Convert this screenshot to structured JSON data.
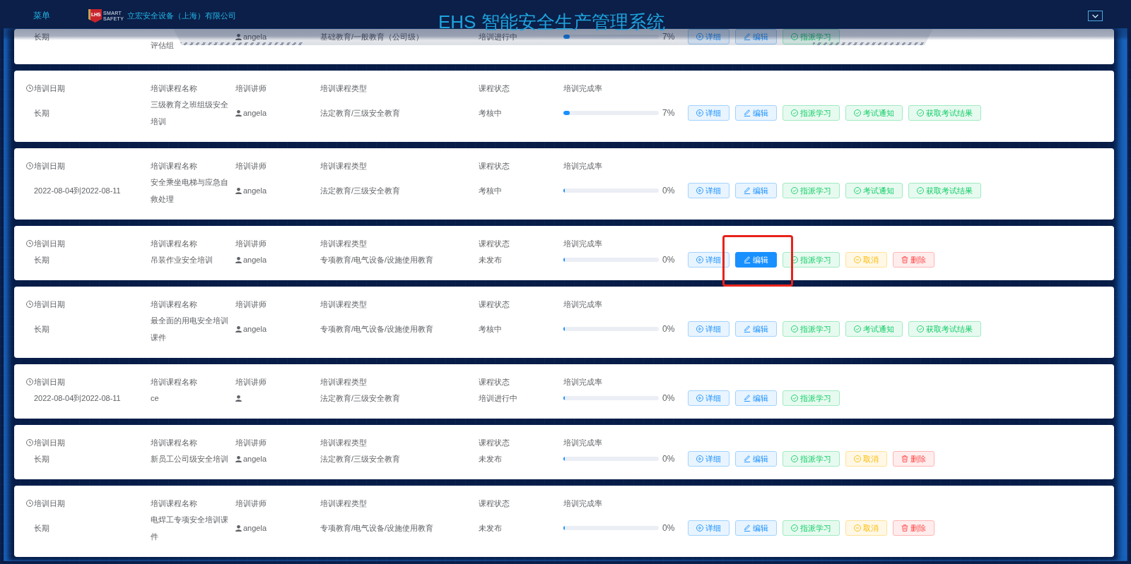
{
  "header": {
    "menu": "菜单",
    "logo": {
      "badge": "LHS",
      "line_1": "SMART",
      "line_2": "SAFETY"
    },
    "company": "立宏安全设备（上海）有限公司",
    "title": "EHS 智能安全生产管理系统"
  },
  "cards": [
    {
      "partial": true,
      "date": "长期",
      "course": "评估组",
      "teacher": "angela",
      "type": "基础教育/一般教育（公司级）",
      "status": "培训进行中",
      "progress": {
        "level": 0.07,
        "reading": "7%"
      },
      "buttons": [
        {
          "kind": "detail",
          "label": "详细",
          "active": false,
          "marked": false
        },
        {
          "kind": "edit",
          "label": "编辑",
          "active": false,
          "marked": false
        },
        {
          "kind": "assign",
          "label": "指派学习",
          "active": false,
          "marked": false
        }
      ]
    },
    {
      "partial": false,
      "labels": [
        "培训日期",
        "培训课程名称",
        "培训讲师",
        "培训课程类型",
        "课程状态",
        "培训完成率"
      ],
      "date": "长期",
      "course": "三级教育之班组级安全培训",
      "teacher": "angela",
      "type": "法定教育/三级安全教育",
      "status": "考核中",
      "progress": {
        "level": 0.07,
        "reading": "7%"
      },
      "buttons": [
        {
          "kind": "detail",
          "label": "详细",
          "active": false,
          "marked": false
        },
        {
          "kind": "edit",
          "label": "编辑",
          "active": false,
          "marked": false
        },
        {
          "kind": "assign",
          "label": "指派学习",
          "active": false,
          "marked": false
        },
        {
          "kind": "notify",
          "label": "考试通知",
          "active": false,
          "marked": false
        },
        {
          "kind": "result",
          "label": "获取考试结果",
          "active": false,
          "marked": false
        }
      ]
    },
    {
      "partial": false,
      "labels": [
        "培训日期",
        "培训课程名称",
        "培训讲师",
        "培训课程类型",
        "课程状态",
        "培训完成率"
      ],
      "date": "2022-08-04到2022-08-11",
      "course": "安全乘坐电梯与应急自救处理",
      "teacher": "angela",
      "type": "法定教育/三级安全教育",
      "status": "考核中",
      "progress": {
        "level": 0,
        "reading": "0%"
      },
      "buttons": [
        {
          "kind": "detail",
          "label": "详细",
          "active": false,
          "marked": false
        },
        {
          "kind": "edit",
          "label": "编辑",
          "active": false,
          "marked": false
        },
        {
          "kind": "assign",
          "label": "指派学习",
          "active": false,
          "marked": false
        },
        {
          "kind": "notify",
          "label": "考试通知",
          "active": false,
          "marked": false
        },
        {
          "kind": "result",
          "label": "获取考试结果",
          "active": false,
          "marked": false
        }
      ]
    },
    {
      "partial": false,
      "labels": [
        "培训日期",
        "培训课程名称",
        "培训讲师",
        "培训课程类型",
        "课程状态",
        "培训完成率"
      ],
      "date": "长期",
      "course": "吊装作业安全培训",
      "teacher": "angela",
      "type": "专项教育/电气设备/设施使用教育",
      "status": "未发布",
      "progress": {
        "level": 0,
        "reading": "0%"
      },
      "buttons": [
        {
          "kind": "detail",
          "label": "详细",
          "active": false,
          "marked": false
        },
        {
          "kind": "edit",
          "label": "编辑",
          "active": true,
          "marked": true
        },
        {
          "kind": "assign",
          "label": "指派学习",
          "active": false,
          "marked": false
        },
        {
          "kind": "cancel",
          "label": "取消",
          "active": false,
          "marked": false
        },
        {
          "kind": "delete",
          "label": "删除",
          "active": false,
          "marked": false
        }
      ]
    },
    {
      "partial": false,
      "labels": [
        "培训日期",
        "培训课程名称",
        "培训讲师",
        "培训课程类型",
        "课程状态",
        "培训完成率"
      ],
      "date": "长期",
      "course": "最全面的用电安全培训课件",
      "teacher": "angela",
      "type": "专项教育/电气设备/设施使用教育",
      "status": "考核中",
      "progress": {
        "level": 0,
        "reading": "0%"
      },
      "buttons": [
        {
          "kind": "detail",
          "label": "详细",
          "active": false,
          "marked": false
        },
        {
          "kind": "edit",
          "label": "编辑",
          "active": false,
          "marked": false
        },
        {
          "kind": "assign",
          "label": "指派学习",
          "active": false,
          "marked": false
        },
        {
          "kind": "notify",
          "label": "考试通知",
          "active": false,
          "marked": false
        },
        {
          "kind": "result",
          "label": "获取考试结果",
          "active": false,
          "marked": false
        }
      ]
    },
    {
      "partial": false,
      "labels": [
        "培训日期",
        "培训课程名称",
        "培训讲师",
        "培训课程类型",
        "课程状态",
        "培训完成率"
      ],
      "date": "2022-08-04到2022-08-11",
      "course": "ce",
      "type": "法定教育/三级安全教育",
      "status": "培训进行中",
      "progress": {
        "level": 0,
        "reading": "0%"
      },
      "buttons": [
        {
          "kind": "detail",
          "label": "详细",
          "active": false,
          "marked": false
        },
        {
          "kind": "edit",
          "label": "编辑",
          "active": false,
          "marked": false
        },
        {
          "kind": "assign",
          "label": "指派学习",
          "active": false,
          "marked": false
        }
      ]
    },
    {
      "partial": false,
      "labels": [
        "培训日期",
        "培训课程名称",
        "培训讲师",
        "培训课程类型",
        "课程状态",
        "培训完成率"
      ],
      "date": "长期",
      "course": "新员工公司级安全培训",
      "teacher": "angela",
      "type": "法定教育/三级安全教育",
      "status": "未发布",
      "progress": {
        "level": 0,
        "reading": "0%"
      },
      "buttons": [
        {
          "kind": "detail",
          "label": "详细",
          "active": false,
          "marked": false
        },
        {
          "kind": "edit",
          "label": "编辑",
          "active": false,
          "marked": false
        },
        {
          "kind": "assign",
          "label": "指派学习",
          "active": false,
          "marked": false
        },
        {
          "kind": "cancel",
          "label": "取消",
          "active": false,
          "marked": false
        },
        {
          "kind": "delete",
          "label": "删除",
          "active": false,
          "marked": false
        }
      ]
    },
    {
      "partial": false,
      "labels": [
        "培训日期",
        "培训课程名称",
        "培训讲师",
        "培训课程类型",
        "课程状态",
        "培训完成率"
      ],
      "date": "长期",
      "course": "电焊工专项安全培训课件",
      "teacher": "angela",
      "type": "专项教育/电气设备/设施使用教育",
      "status": "未发布",
      "progress": {
        "level": 0,
        "reading": "0%"
      },
      "buttons": [
        {
          "kind": "detail",
          "label": "详细",
          "active": false,
          "marked": false
        },
        {
          "kind": "edit",
          "label": "编辑",
          "active": false,
          "marked": false
        },
        {
          "kind": "assign",
          "label": "指派学习",
          "active": false,
          "marked": false
        },
        {
          "kind": "cancel",
          "label": "取消",
          "active": false,
          "marked": false
        },
        {
          "kind": "delete",
          "label": "删除",
          "active": false,
          "marked": false
        }
      ]
    }
  ]
}
